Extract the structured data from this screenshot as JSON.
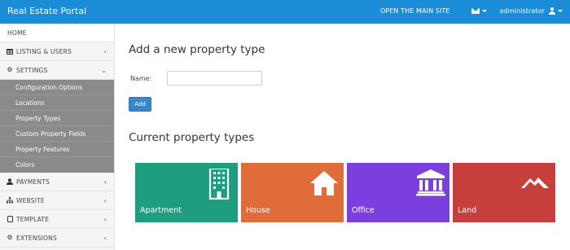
{
  "app": {
    "title": "Real Estate Portal"
  },
  "topbar": {
    "main_site_link": "OPEN THE MAIN SITE",
    "user_name": "administrator"
  },
  "sidebar": {
    "home": "HOME",
    "listing_users": "LISTING & USERS",
    "settings": "SETTINGS",
    "settings_sub": [
      "Configuration Options",
      "Locations",
      "Property Types",
      "Custom Property Fields",
      "Property Features",
      "Colors"
    ],
    "payments": "PAYMENTS",
    "website": "WEBSITE",
    "template": "TEMPLATE",
    "extensions": "EXTENSIONS"
  },
  "main": {
    "add_heading": "Add a new property type",
    "name_label": "Name:",
    "name_value": "",
    "add_button": "Add",
    "current_heading": "Current property types",
    "types": [
      {
        "label": "Apartment",
        "icon": "building-icon",
        "color": "#1e9e7f"
      },
      {
        "label": "House",
        "icon": "house-icon",
        "color": "#e06c3c"
      },
      {
        "label": "Office",
        "icon": "institution-icon",
        "color": "#7b3fe0"
      },
      {
        "label": "Land",
        "icon": "mountain-icon",
        "color": "#c63f3c"
      }
    ]
  }
}
